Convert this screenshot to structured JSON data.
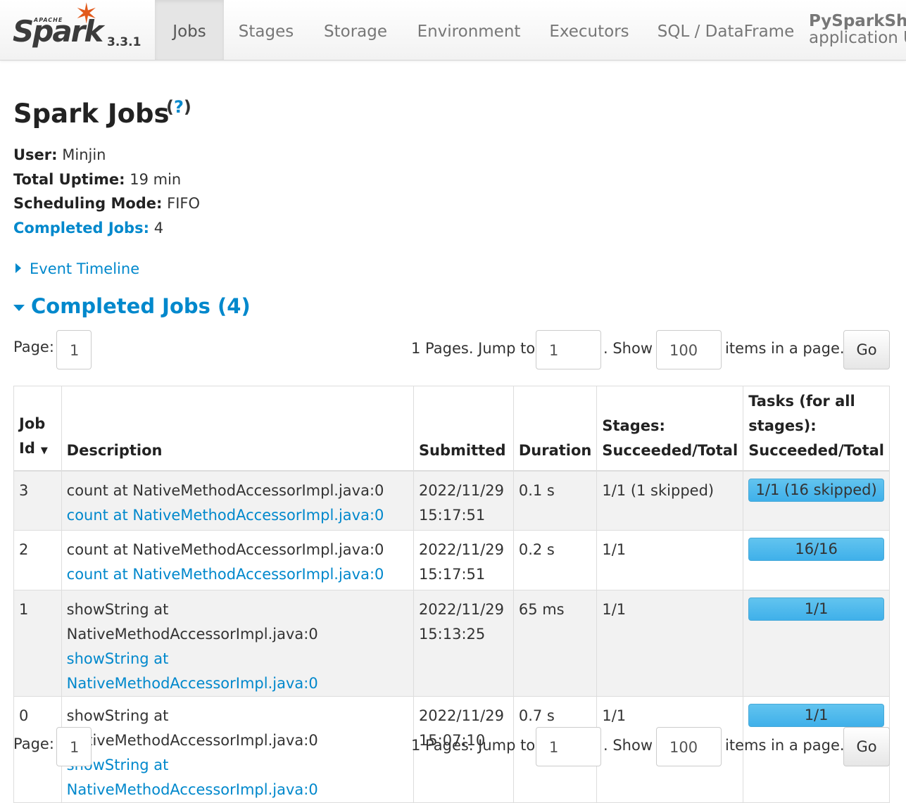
{
  "brand": {
    "apache": "APACHE",
    "name": "Spark",
    "version": "3.3.1"
  },
  "nav": {
    "tabs": [
      {
        "label": "Jobs",
        "active": true
      },
      {
        "label": "Stages"
      },
      {
        "label": "Storage"
      },
      {
        "label": "Environment"
      },
      {
        "label": "Executors"
      },
      {
        "label": "SQL / DataFrame"
      }
    ],
    "app_name": "PySparkShell",
    "app_sub": "application UI"
  },
  "page": {
    "title": "Spark Jobs",
    "help": "?",
    "user_label": "User:",
    "user": "Minjin",
    "uptime_label": "Total Uptime:",
    "uptime": "19 min",
    "mode_label": "Scheduling Mode:",
    "mode": "FIFO",
    "completed_label": "Completed Jobs:",
    "completed": "4",
    "event_timeline": "Event Timeline",
    "section_title": "Completed Jobs (4)"
  },
  "pager": {
    "page_label": "Page:",
    "page_value": "1",
    "pages_text": "1 Pages. Jump to",
    "jump_value": "1",
    "show_text": ". Show",
    "show_value": "100",
    "items_text": "items in a page.",
    "go_label": "Go"
  },
  "table": {
    "headers": {
      "job_id_1": "Job",
      "job_id_2": "Id",
      "sort_arrow": "▼",
      "description": "Description",
      "submitted": "Submitted",
      "duration": "Duration",
      "stages_1": "Stages:",
      "stages_2": "Succeeded/Total",
      "tasks_1": "Tasks (for all",
      "tasks_2": "stages):",
      "tasks_3": "Succeeded/Total"
    },
    "rows": [
      {
        "id": "3",
        "desc": "count at NativeMethodAccessorImpl.java:0",
        "desc_link": "count at NativeMethodAccessorImpl.java:0",
        "date": "2022/11/29",
        "time": "15:17:51",
        "duration": "0.1 s",
        "stages": "1/1 (1 skipped)",
        "tasks": "1/1 (16 skipped)",
        "progress": 1.0
      },
      {
        "id": "2",
        "desc": "count at NativeMethodAccessorImpl.java:0",
        "desc_link": "count at NativeMethodAccessorImpl.java:0",
        "date": "2022/11/29",
        "time": "15:17:51",
        "duration": "0.2 s",
        "stages": "1/1",
        "tasks": "16/16",
        "progress": 1.0
      },
      {
        "id": "1",
        "desc": "showString at NativeMethodAccessorImpl.java:0",
        "desc_link": "showString at NativeMethodAccessorImpl.java:0",
        "date": "2022/11/29",
        "time": "15:13:25",
        "duration": "65 ms",
        "stages": "1/1",
        "tasks": "1/1",
        "progress": 1.0
      },
      {
        "id": "0",
        "desc": "showString at NativeMethodAccessorImpl.java:0",
        "desc_link": "showString at NativeMethodAccessorImpl.java:0",
        "date": "2022/11/29",
        "time": "15:07:10",
        "duration": "0.7 s",
        "stages": "1/1",
        "tasks": "1/1",
        "progress": 1.0
      }
    ]
  },
  "colors": {
    "link": "#0088cc",
    "progress": "#3fb0ea",
    "spark_orange": "#e25a1c"
  }
}
